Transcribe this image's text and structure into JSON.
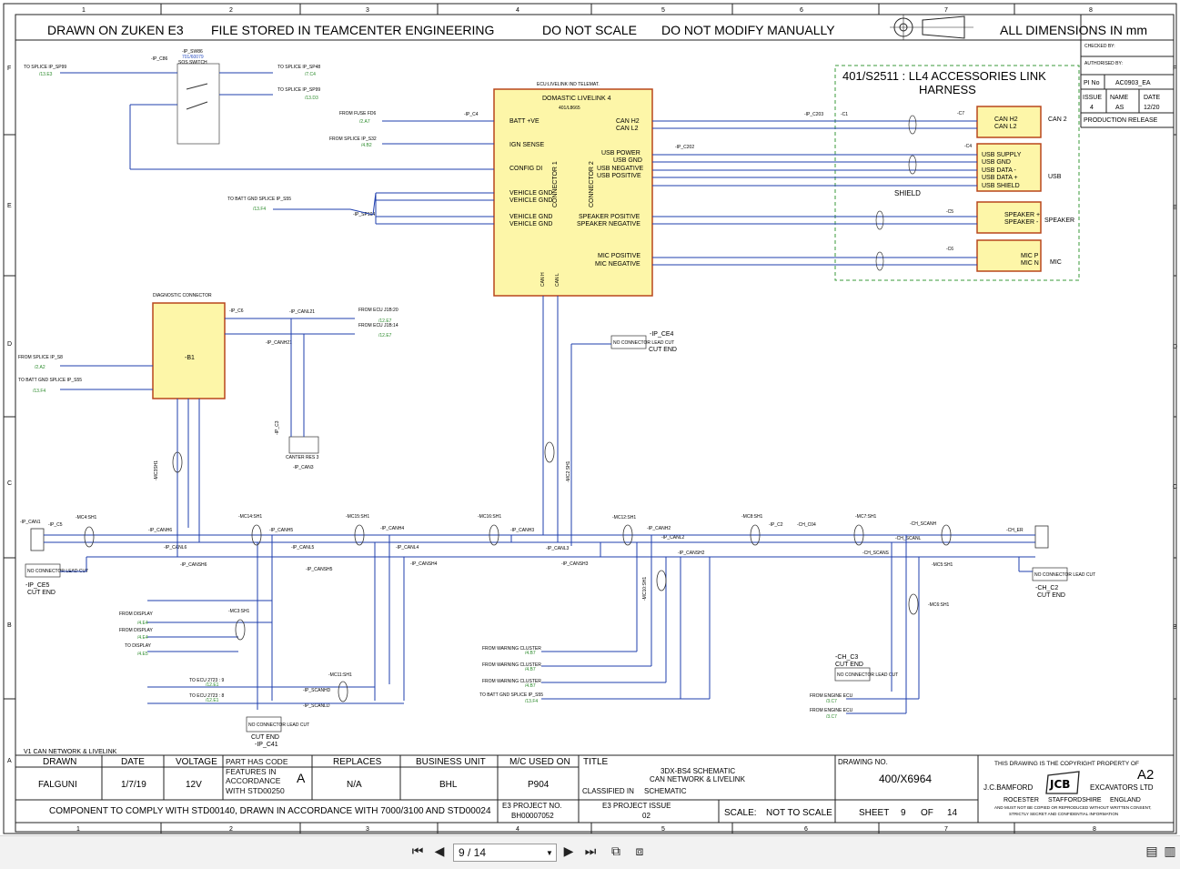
{
  "header": {
    "drawn_on": "DRAWN ON ZUKEN E3",
    "file_stored": "FILE STORED IN TEAMCENTER ENGINEERING",
    "do_not_scale": "DO NOT SCALE",
    "do_not_modify": "DO NOT MODIFY MANUALLY",
    "dimensions": "ALL DIMENSIONS IN mm"
  },
  "grid": {
    "cols": [
      "1",
      "2",
      "3",
      "4",
      "5",
      "6",
      "7",
      "8"
    ],
    "rows": [
      "F",
      "E",
      "D",
      "C",
      "B",
      "A"
    ]
  },
  "revision_box": {
    "checked_by": "CHECKED BY:",
    "authorised_by": "AUTHORISED BY:",
    "pi_no_label": "PI No",
    "pi_no": "AC0903_EA",
    "issue_label": "ISSUE",
    "name_label": "NAME",
    "date_label": "DATE",
    "issue": "4",
    "name": "AS",
    "date": "12/20",
    "status": "PRODUCTION RELEASE"
  },
  "harness": {
    "title": "401/S2511 : LL4 ACCESSORIES LINK",
    "subtitle": "HARNESS",
    "shield": "SHIELD",
    "c7": "-C7",
    "c7_pins": [
      "CAN H2",
      "CAN L2"
    ],
    "c7_group": "CAN 2",
    "c4": "-C4",
    "c4_pins": [
      "USB SUPPLY",
      "USB GND",
      "USB DATA -",
      "USB DATA +",
      "USB SHIELD"
    ],
    "c4_group": "USB",
    "c5": "-C5",
    "c5_pins": [
      "SPEAKER +",
      "SPEAKER -"
    ],
    "c5_group": "SPEAKER",
    "c6": "-C6",
    "c6_pins": [
      "MIC P",
      "MIC N"
    ],
    "c6_group": "MIC"
  },
  "ecu": {
    "caption": "ECU:LIVELINK IND TELEMAT.",
    "name": "DOMASTIC LIVELINK 4",
    "part": "401/L8665",
    "connector1": "CONNECTOR 1",
    "connector2": "CONNECTOR 2",
    "left_pins": [
      "BATT +VE",
      "IGN SENSE",
      "CONFIG DI",
      "VEHICLE GND",
      "VEHICLE GND",
      "VEHICLE GND",
      "VEHICLE GND"
    ],
    "right_pins": [
      "CAN H2",
      "CAN L2",
      "USB POWER",
      "USB GND",
      "USB NEGATIVE",
      "USB POSITIVE",
      "SPEAKER POSITIVE",
      "SPEAKER NEGATIVE",
      "MIC POSITIVE",
      "MIC NEGATIVE"
    ],
    "bottom_pins": [
      "CAN H",
      "CAN L"
    ],
    "conn_c4": "-IP_C4",
    "conn_c203": "-IP_C203",
    "conn_c202": "-IP_C202",
    "conn_c1": "-C1"
  },
  "sos": {
    "ref": "-IP_SW86",
    "part": "701/60079",
    "name": "SOS SWITCH",
    "conn": "-IP_C86"
  },
  "refs": {
    "to_splice_sp99": "TO SPLICE IP_SP99",
    "to_splice_sp99_ref": "/13.E3",
    "to_splice_sp48": "TO SPLICE IP_SP48",
    "to_splice_sp48_ref": "/7.C4",
    "to_splice_sp99b": "TO SPLICE IP_SP99",
    "to_splice_sp99b_ref": "/13.D3",
    "from_fuse_fd6": "FROM FUSE FD6",
    "from_fuse_fd6_ref": "/2.A7",
    "from_splice_s32": "FROM SPLICE IP_S32",
    "from_splice_s32_ref": "/4.B2",
    "to_batt_gnd_s55": "TO BATT GND SPLICE IP_S55",
    "to_batt_gnd_s55_ref": "/13.F4",
    "ip_sp104": "-IP_SP104"
  },
  "diag": {
    "title": "DIAGNOSTIC CONNECTOR",
    "ref": "-B1",
    "conn_c6": "-IP_C6",
    "from_splice_s8": "FROM SPLICE IP_S8",
    "from_splice_s8_ref": "/2.A2",
    "to_batt_gnd_s55": "TO BATT GND SPLICE IP_S55",
    "to_batt_gnd_s55_ref": "/13.F4",
    "from_ecu_j1b20": "FROM ECU J1B:20",
    "from_ecu_j1b20_ref": "/12.E7",
    "from_ecu_j1b14": "FROM ECU J1B:14",
    "from_ecu_j1b14_ref": "/12.E7",
    "canl21": "-IP_CANL21",
    "canh21": "-IP_CANH21",
    "c3": "-IP_C3",
    "canter_res": "CANTER RES 3",
    "can3": "-IP_CAN3"
  },
  "can_bus": {
    "ip_can1": "-IP_CAN1",
    "ip_c5": "-IP_C5",
    "ip_ce5": "-IP_CE5",
    "ip_ce5_end": "CUT END",
    "ip_ce4": "-IP_CE4",
    "ip_ce4_end": "CUT END",
    "ch_er": "-CH_ER",
    "ch_c2": "-CH_C2",
    "ch_c2_end": "CUT END",
    "ch_c3": "-CH_C3",
    "ch_c3_end": "CUT END",
    "ip_c41": "-IP_C41",
    "ip_c41_end": "CUT END",
    "no_connector": "NO CONNECTOR LEAD CUT",
    "shields": [
      "-MC4:SH1",
      "-MC14:SH1",
      "-MC15:SH1",
      "-MC16:SH1",
      "-MC12:SH1",
      "-MC8:SH1",
      "-MC7:SH1",
      "-MC5:SH1",
      "-MC6:SH1",
      "-MC3:SH1",
      "-MC11:SH1",
      "-MC10:SH1",
      "-MC2:SH1",
      "-MC3SH1"
    ],
    "nets": [
      "-IP_CANH6",
      "-IP_CANL6",
      "-IP_CANSH6",
      "-IP_CANH5",
      "-IP_CANL5",
      "-IP_CANSH5",
      "-IP_CANH4",
      "-IP_CANL4",
      "-IP_CANSH4",
      "-IP_CANH3",
      "-IP_CANL3",
      "-IP_CANSH3",
      "-IP_CANH2",
      "-IP_CANL2",
      "-IP_CANSH2",
      "-CH_SCANH",
      "-CH_SCANL",
      "-CH_SCANS",
      "-IP_SCANHD",
      "-IP_SCANLD"
    ],
    "from_display_1": "FROM DISPLAY",
    "from_display_1_ref": "/4.E4",
    "from_display_2": "FROM DISPLAY",
    "from_display_2_ref": "/4.E4",
    "to_display": "TO DISPLAY",
    "to_display_ref": "/4.E5",
    "to_ecu_1": "TO ECU 2723 : 9",
    "to_ecu_1_ref": "/12.E1",
    "to_ecu_2": "TO ECU 2723 : 8",
    "to_ecu_2_ref": "/12.E1",
    "from_warning_1": "FROM WARNING CLUSTER",
    "from_warning_1_ref": "/4.B7",
    "from_warning_2": "FROM WARNING CLUSTER",
    "from_warning_2_ref": "/4.B7",
    "from_warning_3": "FROM WARNING CLUSTER",
    "from_warning_3_ref": "/4.B7",
    "to_batt_gnd_s55": "TO BATT GND SPLICE IP_S55",
    "to_batt_gnd_s55_ref": "/13.F4",
    "from_engine_1": "FROM ENGINE ECU",
    "from_engine_1_ref": "/3.C7",
    "from_engine_2": "FROM ENGINE ECU",
    "from_engine_2_ref": "/3.C7",
    "ch_c04": "-CH_C04",
    "ip_c2": "-IP_C2",
    "ch_scanh": "-CH_SCANH",
    "ch_scanl": "-CH_SCANL"
  },
  "sheet_label": "V1    CAN NETWORK & LIVELINK",
  "title_block": {
    "drawn_label": "DRAWN",
    "date_label": "DATE",
    "voltage_label": "VOLTAGE",
    "drawn": "FALGUNI",
    "date": "1/7/19",
    "voltage": "12V",
    "part_code": "PART HAS CODE FEATURES IN ACCORDANCE WITH STD00250",
    "part_code_letter": "A",
    "replaces_label": "REPLACES",
    "replaces": "N/A",
    "business_unit_label": "BUSINESS UNIT",
    "business_unit": "BHL",
    "mc_used_label": "M/C USED ON",
    "mc_used": "P904",
    "title_label": "TITLE",
    "title1": "3DX-BS4 SCHEMATIC",
    "title2": "CAN NETWORK & LIVELINK",
    "classified_label": "CLASSIFIED IN",
    "classified": "SCHEMATIC",
    "drawing_no_label": "DRAWING NO.",
    "drawing_no": "400/X6964",
    "e3_project_label": "E3 PROJECT NO.",
    "e3_project": "BH00007052",
    "e3_issue_label": "E3 PROJECT ISSUE",
    "e3_issue": "02",
    "scale_label": "SCALE:",
    "scale": "NOT TO SCALE",
    "sheet_label": "SHEET",
    "sheet": "9",
    "of_label": "OF",
    "sheets": "14",
    "comply": "COMPONENT TO COMPLY WITH STD00140, DRAWN IN ACCORDANCE WITH 7000/3100 AND STD00024",
    "copyright": "THIS DRAWING IS THE COPYRIGHT PROPERTY OF",
    "size": "A2",
    "company1": "J.C.BAMFORD",
    "company2": "EXCAVATORS LTD",
    "addr1": "ROCESTER",
    "addr2": "STAFFORDSHIRE",
    "addr3": "ENGLAND",
    "notice1": "AND MUST NOT BE COPIED OR REPRODUCED WITHOUT WRITTEN CONSENT,",
    "notice2": "STRICTLY SECRET AND CONFIDENTIAL INFORMATION",
    "logo": "JCB"
  },
  "viewer": {
    "page_value": "9 / 14"
  },
  "colors": {
    "wire": "#1f3fae",
    "component_fill": "#fdf6a8",
    "component_border": "#b8461c",
    "harness_border": "#3a9a3a",
    "label_green": "#2a8a2a"
  }
}
